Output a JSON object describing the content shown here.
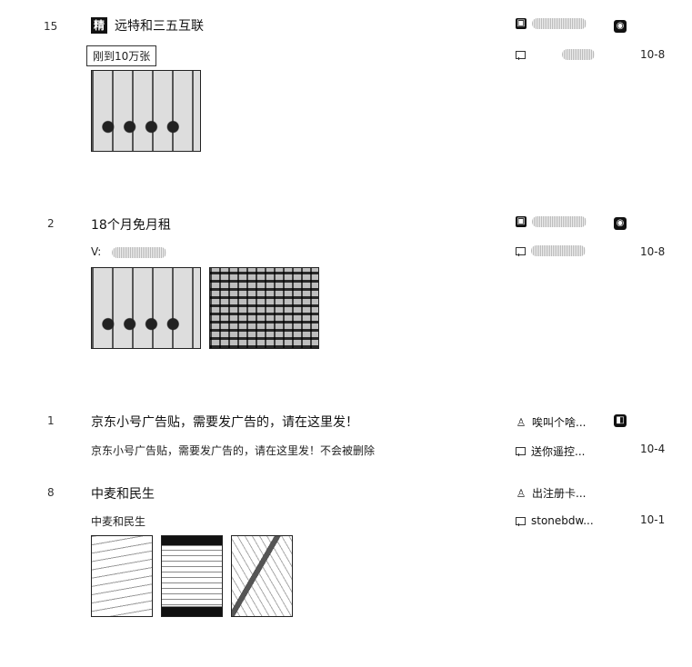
{
  "threads": [
    {
      "reply_count": "15",
      "badge": "精",
      "title": "远特和三五互联",
      "abstract": "刚到10万张",
      "author": "",
      "last_replier": "",
      "date": "10-8",
      "thumbnails": [
        "thumb-1"
      ]
    },
    {
      "reply_count": "2",
      "title": "18个月免月租",
      "abstract": "V:",
      "author": "",
      "last_replier": "",
      "date": "10-8",
      "thumbnails": [
        "thumb-1",
        "thumb-2"
      ]
    },
    {
      "reply_count": "1",
      "title": "京东小号广告贴，需要发广告的，请在这里发！",
      "abstract": "京东小号广告贴，需要发广告的，请在这里发！不会被删除",
      "author": "唉叫个啥...",
      "last_replier": "送你遥控...",
      "date": "10-4"
    },
    {
      "reply_count": "8",
      "title": "中麦和民生",
      "abstract": "中麦和民生",
      "author": "出注册卡...",
      "last_replier": "stonebdw...",
      "date": "10-1",
      "thumbnails": [
        "thumb-1",
        "thumb-2",
        "thumb-3"
      ]
    }
  ]
}
